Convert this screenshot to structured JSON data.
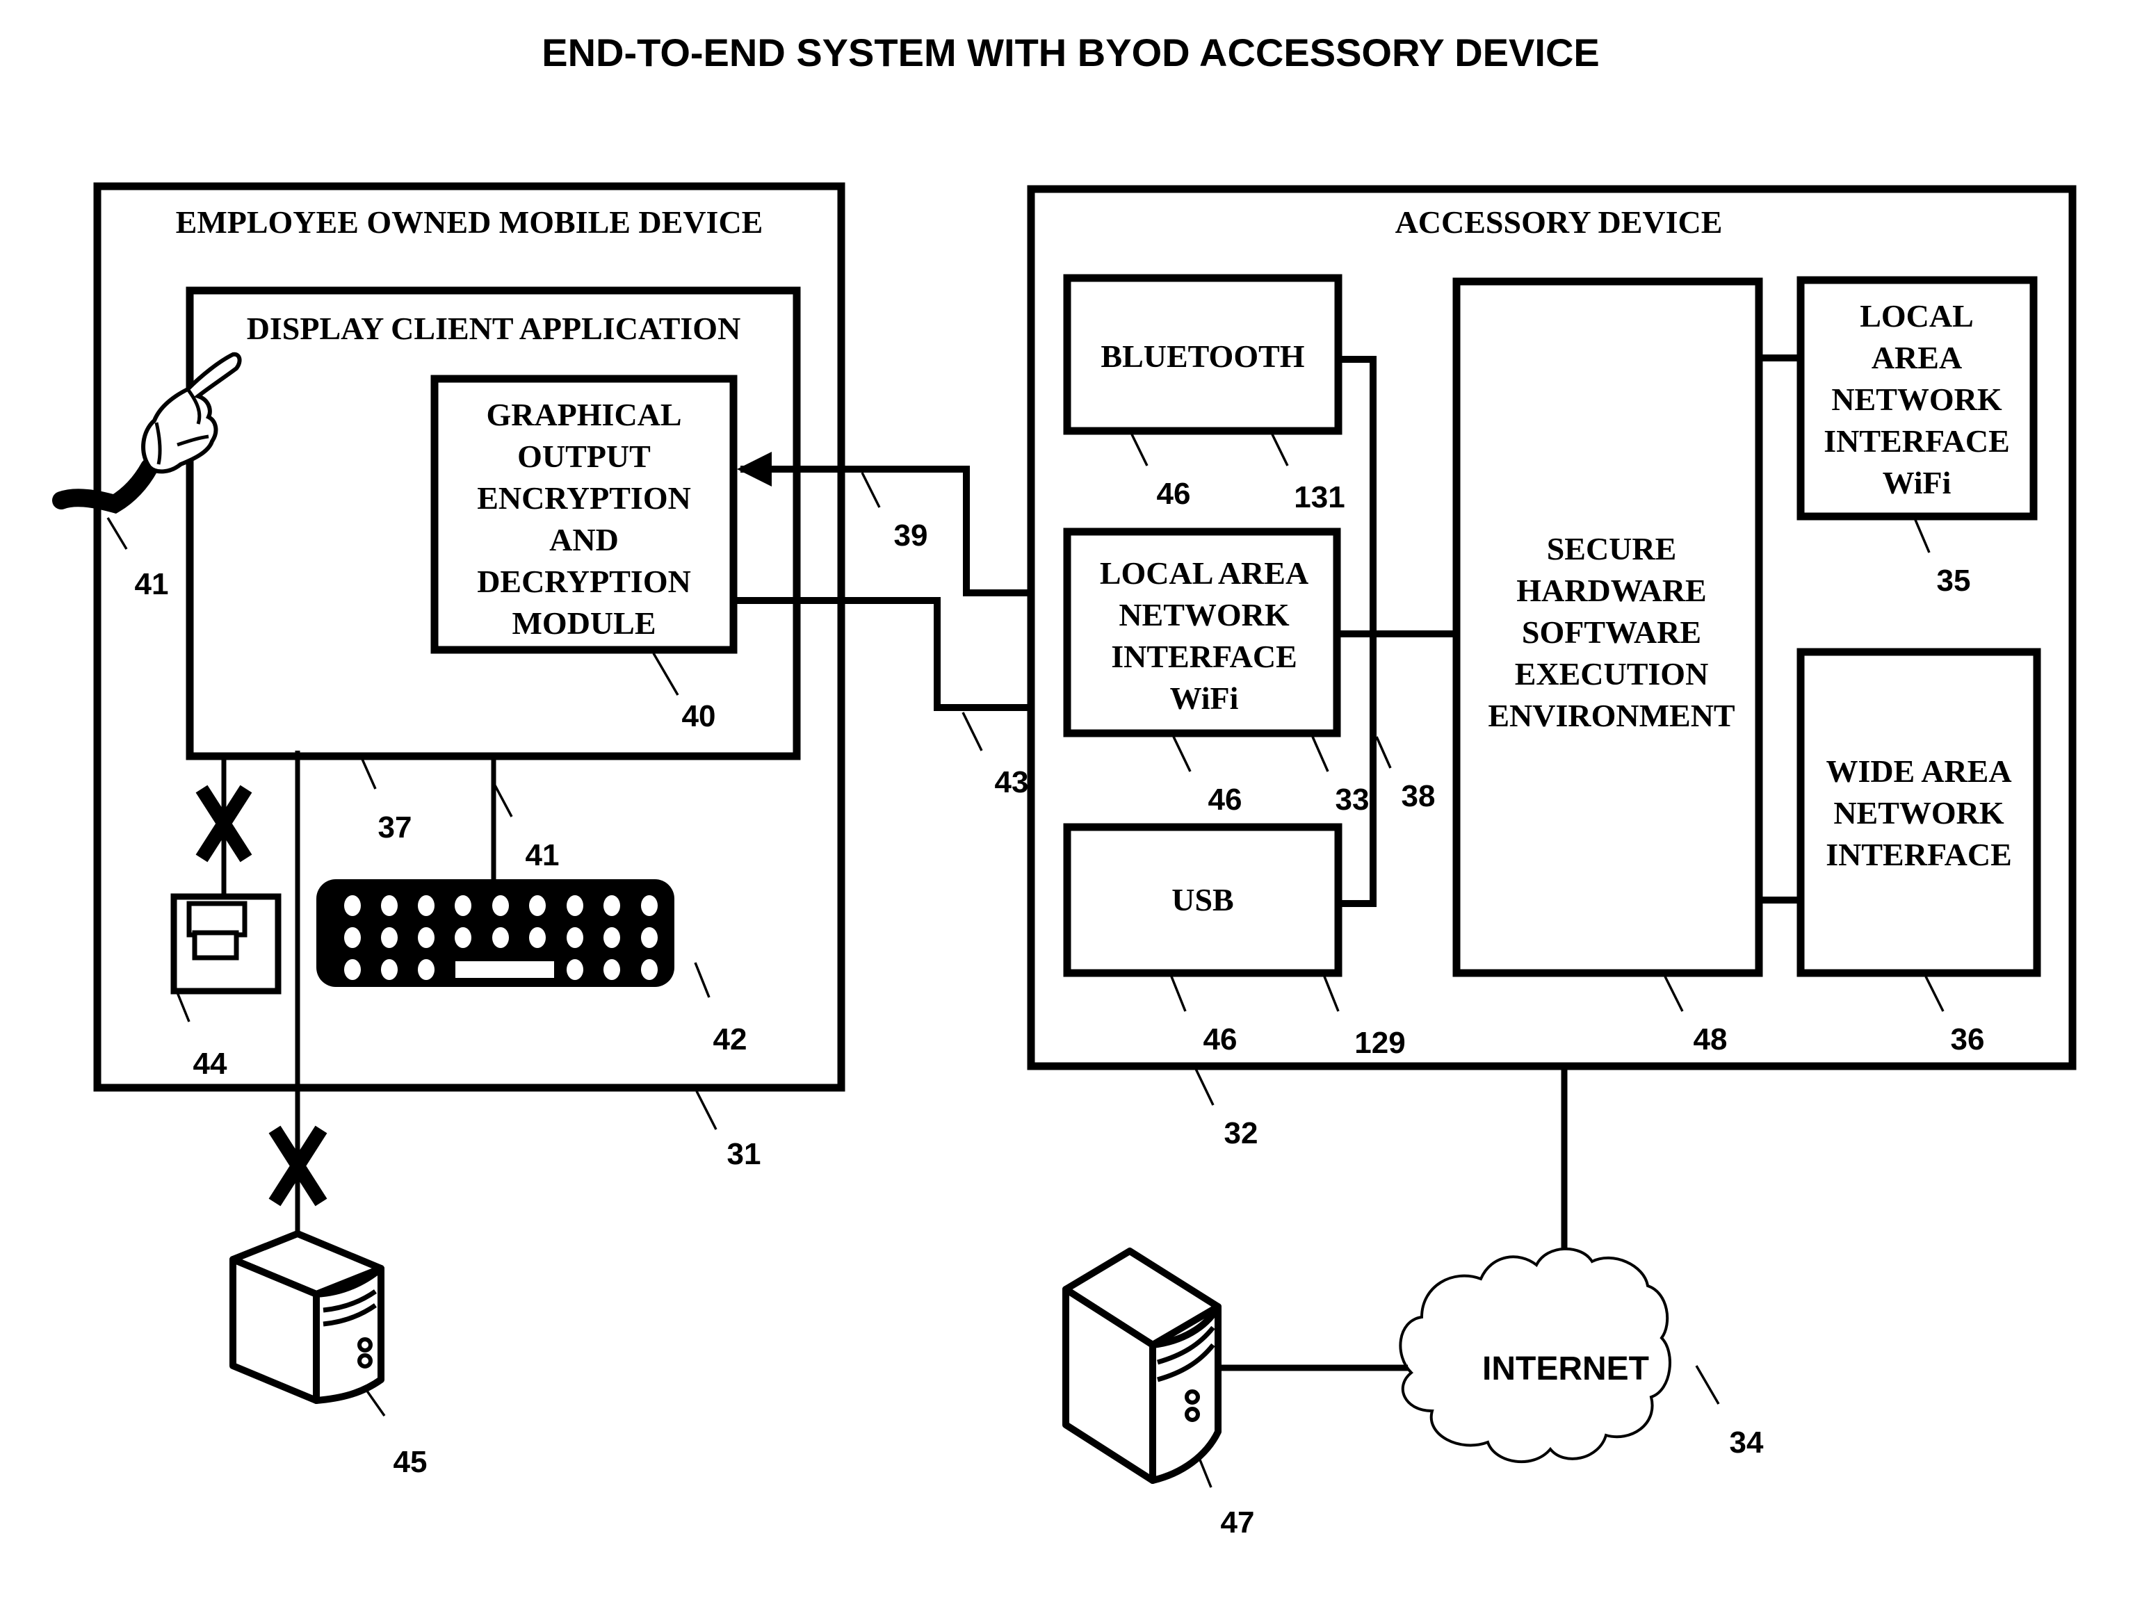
{
  "title": "END-TO-END SYSTEM WITH BYOD ACCESSORY DEVICE",
  "colors": {
    "ink": "#000000",
    "paper": "#ffffff"
  },
  "mobile_device": {
    "label": "EMPLOYEE OWNED MOBILE DEVICE",
    "ref": "31",
    "display_client": {
      "label": "DISPLAY CLIENT APPLICATION",
      "bus_ref": "37",
      "module": {
        "lines": [
          "GRAPHICAL",
          "OUTPUT",
          "ENCRYPTION",
          "AND",
          "DECRYPTION",
          "MODULE"
        ],
        "ref": "40"
      }
    },
    "touch_input": {
      "icon": "pointing-hand-icon",
      "ref": "41"
    },
    "keyboard": {
      "icon": "keyboard-icon",
      "ref": "42",
      "connector_ref": "41"
    },
    "printer": {
      "icon": "printer-icon",
      "ref": "44",
      "blocked": true
    }
  },
  "accessory_device": {
    "label": "ACCESSORY DEVICE",
    "ref": "32",
    "bus_ref": "38",
    "bluetooth": {
      "label": "BLUETOOTH",
      "refs": [
        "46",
        "131"
      ]
    },
    "lan_wifi_left": {
      "lines": [
        "LOCAL AREA",
        "NETWORK",
        "INTERFACE",
        "WiFi"
      ],
      "refs": [
        "46",
        "33"
      ]
    },
    "usb": {
      "label": "USB",
      "refs": [
        "46",
        "129"
      ]
    },
    "secure_env": {
      "lines": [
        "SECURE",
        "HARDWARE",
        "SOFTWARE",
        "EXECUTION",
        "ENVIRONMENT"
      ],
      "ref": "48"
    },
    "lan_wifi_right": {
      "lines": [
        "LOCAL",
        "AREA",
        "NETWORK",
        "INTERFACE",
        "WiFi"
      ],
      "ref": "35"
    },
    "wan": {
      "lines": [
        "WIDE AREA",
        "NETWORK",
        "INTERFACE"
      ],
      "ref": "36"
    }
  },
  "links": {
    "to_module": {
      "ref": "39",
      "direction": "accessory-to-mobile"
    },
    "to_accessory": {
      "ref": "43",
      "direction": "mobile-to-accessory"
    }
  },
  "internet": {
    "label": "INTERNET",
    "ref": "34",
    "icon": "cloud-icon"
  },
  "enterprise_server": {
    "icon": "server-tower-icon",
    "ref": "45",
    "blocked": true
  },
  "remote_server": {
    "icon": "server-tower-icon",
    "ref": "47"
  }
}
